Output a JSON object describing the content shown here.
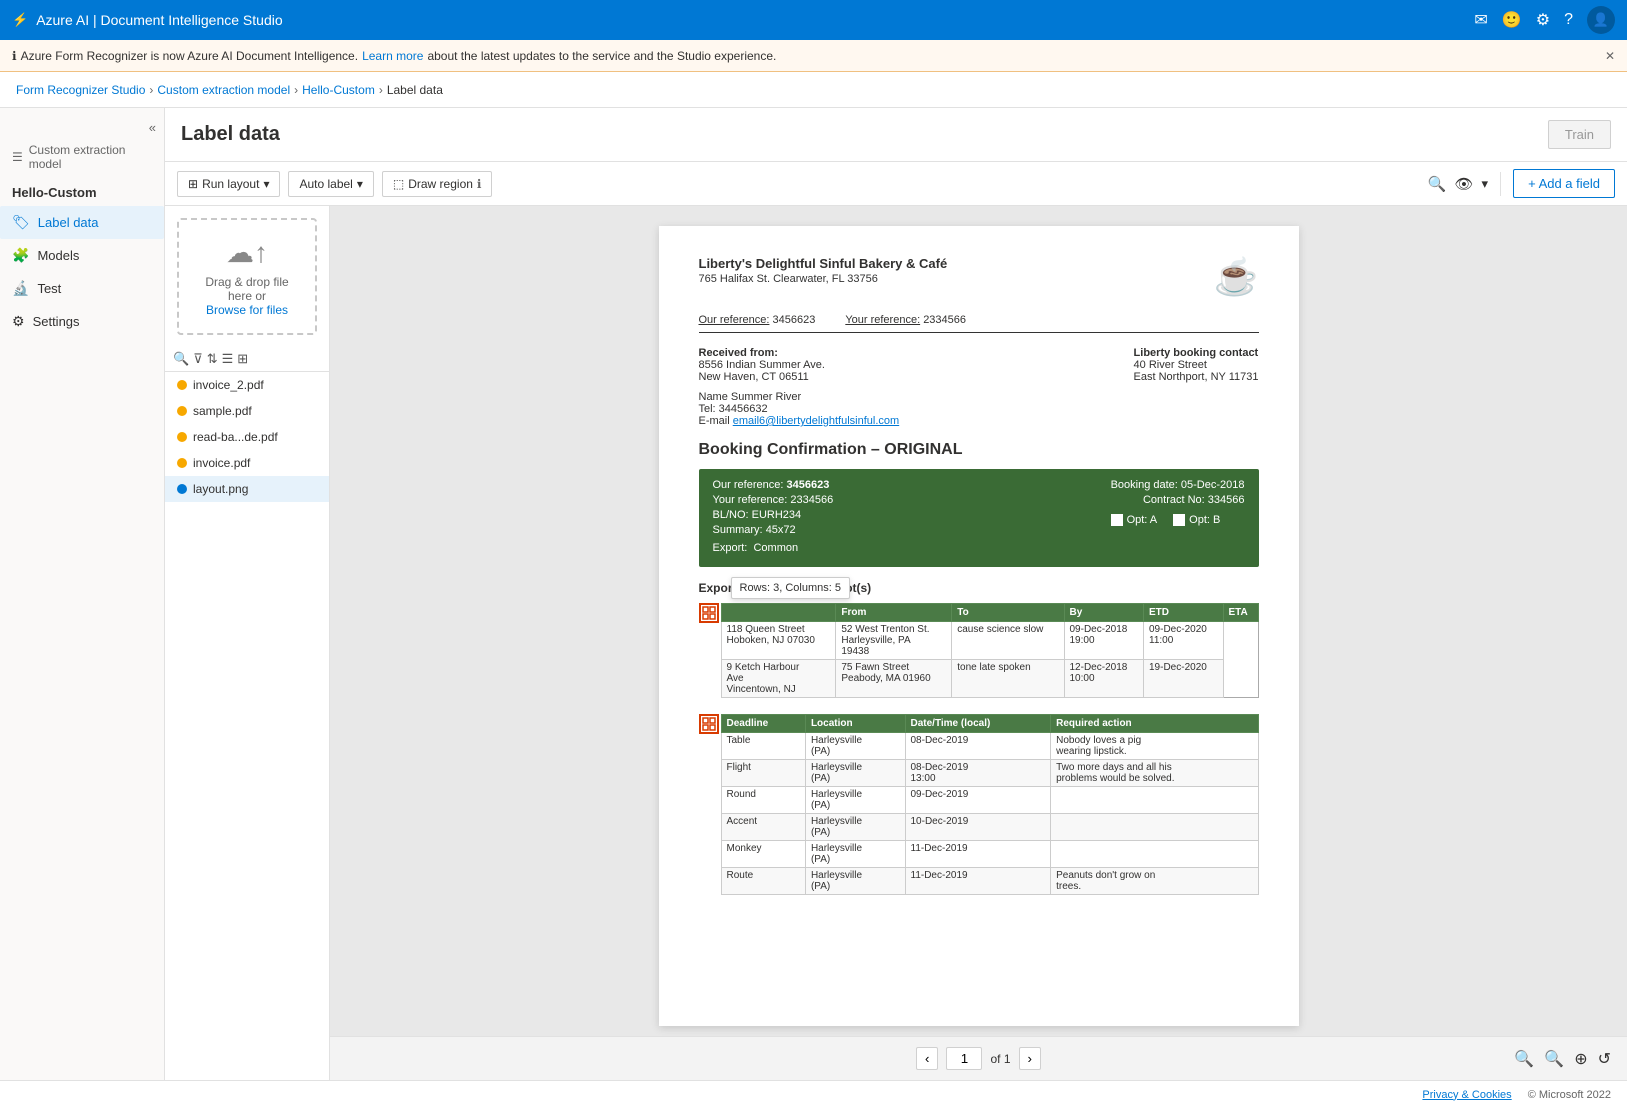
{
  "app": {
    "title": "Azure AI | Document Intelligence Studio",
    "icon": "⚡"
  },
  "notification": {
    "text": "Azure Form Recognizer is now Azure AI Document Intelligence.",
    "link_text": "Learn more",
    "link_suffix": " about the latest updates to the service and the Studio experience."
  },
  "breadcrumb": {
    "items": [
      "Form Recognizer Studio",
      "Custom extraction model",
      "Hello-Custom",
      "Label data"
    ]
  },
  "sidebar": {
    "toggle_label": "«",
    "model_label": "Custom extraction model",
    "project_name": "Hello-Custom",
    "items": [
      {
        "label": "Label data",
        "icon": "🏷",
        "active": true
      },
      {
        "label": "Models",
        "icon": "🧩",
        "active": false
      },
      {
        "label": "Test",
        "icon": "🔬",
        "active": false
      },
      {
        "label": "Settings",
        "icon": "⚙",
        "active": false
      }
    ]
  },
  "page": {
    "title": "Label data",
    "train_btn": "Train"
  },
  "toolbar": {
    "run_layout": "Run layout",
    "auto_label": "Auto label",
    "draw_region": "Draw region",
    "add_field": "+ Add a field"
  },
  "upload": {
    "icon": "☁",
    "line1": "Drag & drop file",
    "line2": "here or",
    "browse": "Browse for files"
  },
  "files": [
    {
      "name": "invoice_2.pdf",
      "color": "orange",
      "selected": false
    },
    {
      "name": "sample.pdf",
      "color": "orange",
      "selected": false
    },
    {
      "name": "read-ba...de.pdf",
      "color": "orange",
      "selected": false
    },
    {
      "name": "invoice.pdf",
      "color": "orange",
      "selected": false
    },
    {
      "name": "layout.png",
      "color": "blue",
      "selected": true
    }
  ],
  "document": {
    "company": "Liberty's Delightful Sinful Bakery & Café",
    "address": "765 Halifax St. Clearwater, FL 33756",
    "our_ref_label": "Our reference:",
    "our_ref": "3456623",
    "your_ref_label": "Your reference:",
    "your_ref": "2334566",
    "received_from": "Received from:",
    "received_addr1": "8556 Indian Summer Ave.",
    "received_addr2": "New Haven, CT 06511",
    "contact_title": "Liberty booking contact",
    "contact_addr1": "40 River Street",
    "contact_addr2": "East Northport, NY 11731",
    "name_label": "Name Summer River",
    "tel_label": "Tel: 34456632",
    "email_label": "E-mail",
    "email": "email6@libertydelightfulsinful.com",
    "booking_title": "Booking Confirmation – ORIGINAL",
    "booking": {
      "our_ref_label": "Our reference:",
      "our_ref_val": "3456623",
      "your_ref_label": "Your reference:",
      "your_ref_val": "2334566",
      "bl_label": "BL/NO:",
      "bl_val": "EURH234",
      "summary_label": "Summary:",
      "summary_val": "45x72",
      "export_label": "Export:",
      "export_val": "Common",
      "booking_date_label": "Booking date:",
      "booking_date_val": "05-Dec-2018",
      "contract_label": "Contract No:",
      "contract_val": "334566",
      "opt_a": "Opt: A",
      "opt_b": "Opt: B"
    },
    "export_section": "Export empty pick up depot(s)",
    "tooltip": "Rows: 3, Columns: 5",
    "table1": {
      "headers": [
        "",
        "From",
        "To",
        "By",
        "ETD",
        "ETA"
      ],
      "rows": [
        [
          "118 Queen Street\nHoboken, NJ 07030",
          "52 West Trenton St.\nHarleysville, PA\n19438",
          "cause science slow",
          "09-Dec-2018\n19:00",
          "09-Dec-2020\n11:00"
        ],
        [
          "9 Ketch Harbour\nAve\nVincentown, NJ",
          "75 Fawn Street\nPeabody, MA 01960",
          "tone late spoken",
          "12-Dec-2018\n10:00",
          "19-Dec-2020"
        ]
      ]
    },
    "table2": {
      "headers": [
        "Deadline",
        "Location",
        "Date/Time (local)",
        "Required action"
      ],
      "rows": [
        [
          "Table",
          "Harleysville\n(PA)",
          "08-Dec-2019",
          "Nobody loves a pig\nwearing lipstick."
        ],
        [
          "Flight",
          "Harleysville\n(PA)",
          "08-Dec-2019\n13:00",
          "Two more days and all his\nproblems would be solved."
        ],
        [
          "Round",
          "Harleysville\n(PA)",
          "09-Dec-2019",
          ""
        ],
        [
          "Accent",
          "Harleysville\n(PA)",
          "10-Dec-2019",
          ""
        ],
        [
          "Monkey",
          "Harleysville\n(PA)",
          "11-Dec-2019",
          ""
        ],
        [
          "Route",
          "Harleysville\n(PA)",
          "11-Dec-2019",
          "Peanuts don't grow on\ntrees."
        ]
      ]
    }
  },
  "pagination": {
    "current": "1",
    "total": "of 1"
  },
  "footer": {
    "privacy": "Privacy & Cookies",
    "copyright": "© Microsoft 2022"
  },
  "colors": {
    "azure_blue": "#0078d4",
    "green_dark": "#3a6b35",
    "orange": "#f7a800"
  }
}
